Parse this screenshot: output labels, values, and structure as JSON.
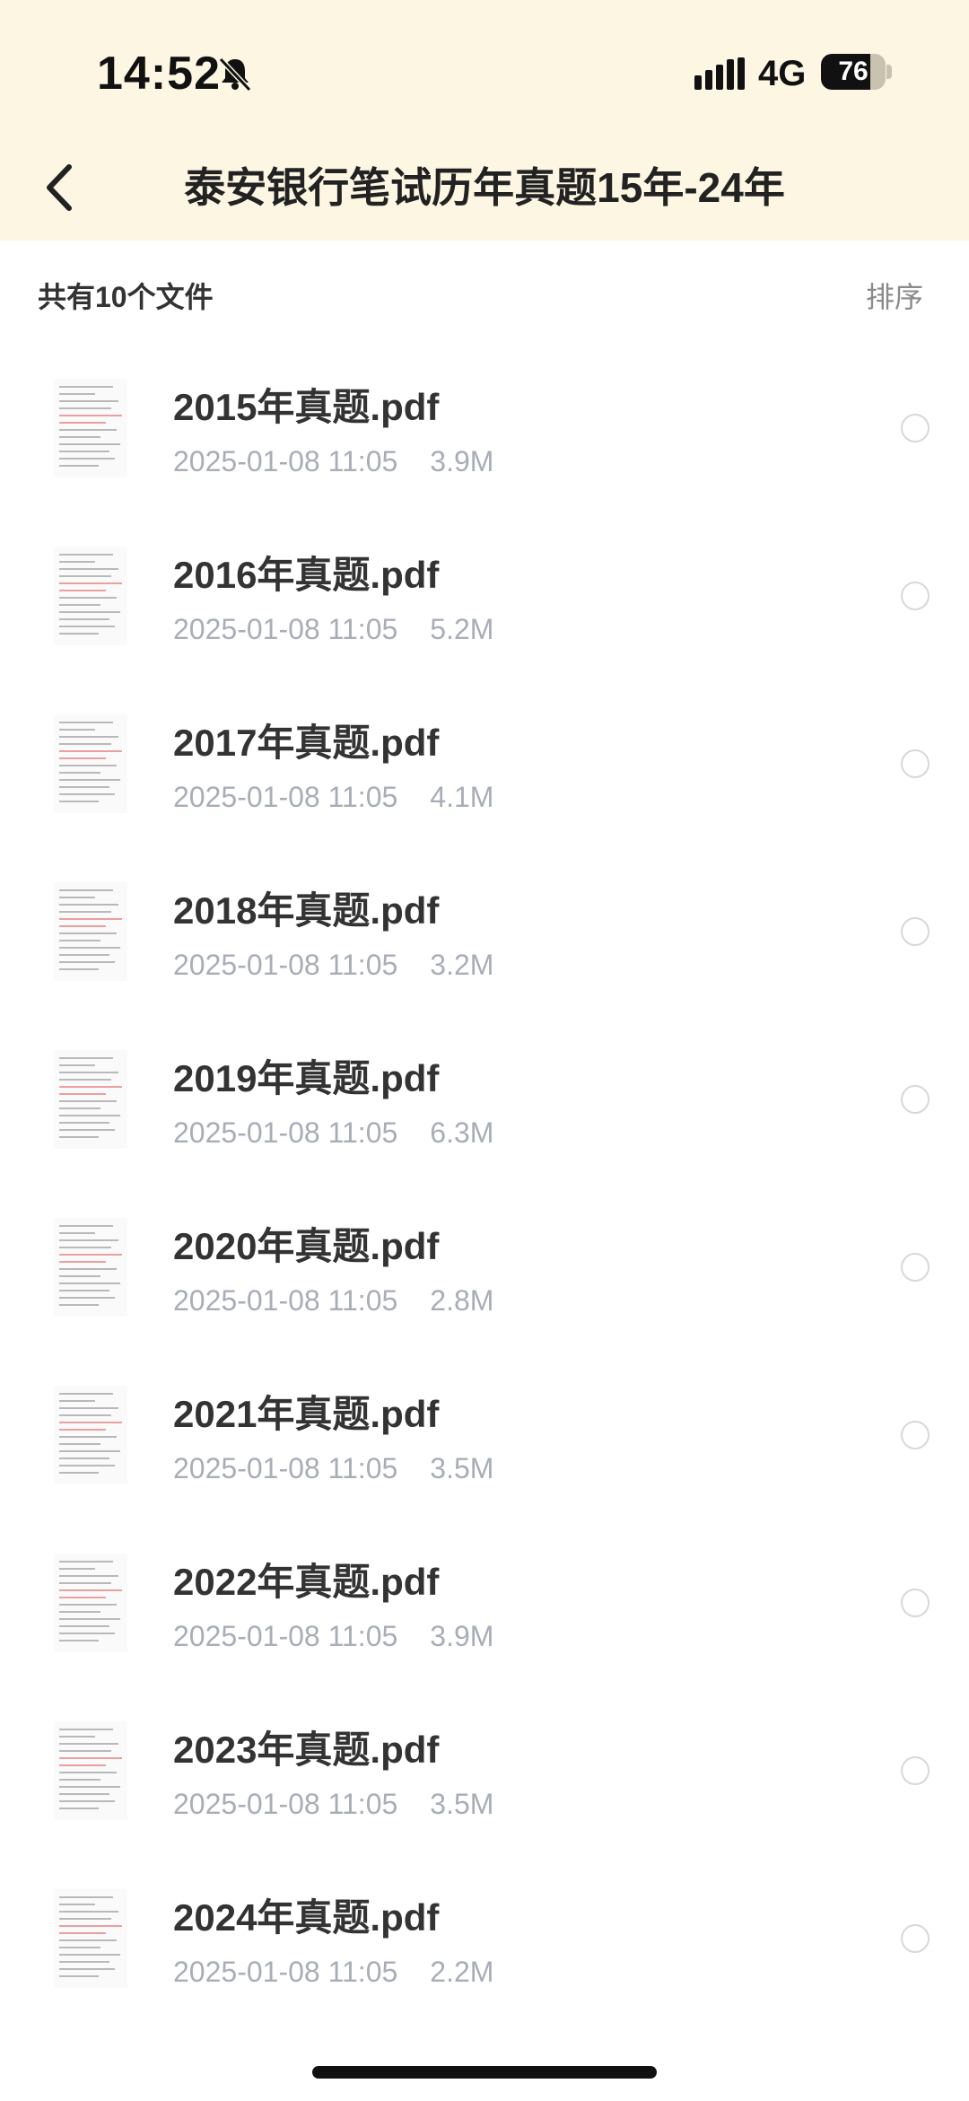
{
  "status_bar": {
    "time": "14:52",
    "network": "4G",
    "battery": "76",
    "battery_level": 0.76,
    "icons": [
      "bell-muted-icon",
      "signal-icon"
    ]
  },
  "header": {
    "back_icon": "chevron-left-icon",
    "title": "泰安银行笔试历年真题15年-24年"
  },
  "subheader": {
    "count_label": "共有10个文件",
    "sort_label": "排序"
  },
  "files": [
    {
      "name": "2015年真题.pdf",
      "date": "2025-01-08 11:05",
      "size": "3.9M"
    },
    {
      "name": "2016年真题.pdf",
      "date": "2025-01-08 11:05",
      "size": "5.2M"
    },
    {
      "name": "2017年真题.pdf",
      "date": "2025-01-08 11:05",
      "size": "4.1M"
    },
    {
      "name": "2018年真题.pdf",
      "date": "2025-01-08 11:05",
      "size": "3.2M"
    },
    {
      "name": "2019年真题.pdf",
      "date": "2025-01-08 11:05",
      "size": "6.3M"
    },
    {
      "name": "2020年真题.pdf",
      "date": "2025-01-08 11:05",
      "size": "2.8M"
    },
    {
      "name": "2021年真题.pdf",
      "date": "2025-01-08 11:05",
      "size": "3.5M"
    },
    {
      "name": "2022年真题.pdf",
      "date": "2025-01-08 11:05",
      "size": "3.9M"
    },
    {
      "name": "2023年真题.pdf",
      "date": "2025-01-08 11:05",
      "size": "3.5M"
    },
    {
      "name": "2024年真题.pdf",
      "date": "2025-01-08 11:05",
      "size": "2.2M"
    }
  ]
}
